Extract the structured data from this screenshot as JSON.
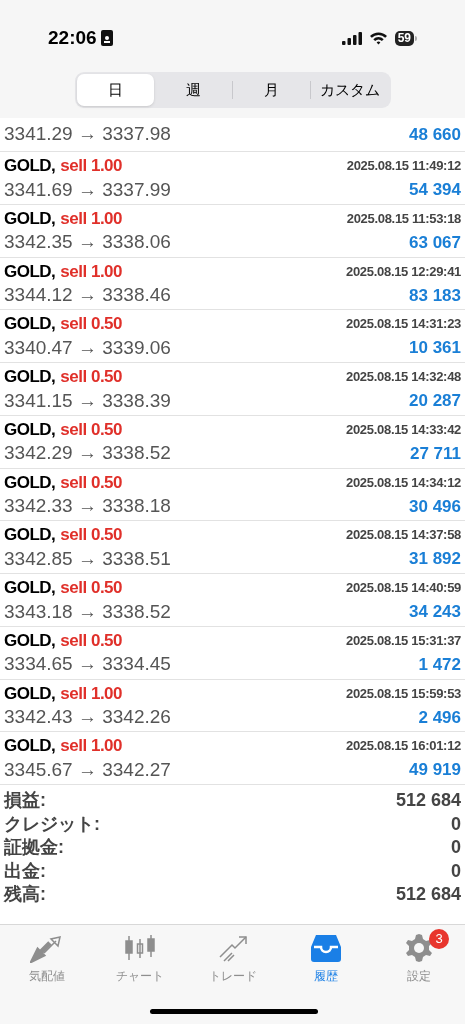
{
  "status_bar": {
    "time": "22:06",
    "battery": "59"
  },
  "period_tabs": [
    {
      "label": "日",
      "selected": true
    },
    {
      "label": "週",
      "selected": false
    },
    {
      "label": "月",
      "selected": false
    },
    {
      "label": "カスタム",
      "selected": false
    }
  ],
  "partial_row": {
    "prices": "3341.29 → 3337.98",
    "profit": "48 660"
  },
  "deals": [
    {
      "symbol": "GOLD,",
      "type": "sell 1.00",
      "time": "2025.08.15 11:49:12",
      "prices": "3341.69 → 3337.99",
      "profit": "54 394"
    },
    {
      "symbol": "GOLD,",
      "type": "sell 1.00",
      "time": "2025.08.15 11:53:18",
      "prices": "3342.35 → 3338.06",
      "profit": "63 067"
    },
    {
      "symbol": "GOLD,",
      "type": "sell 1.00",
      "time": "2025.08.15 12:29:41",
      "prices": "3344.12 → 3338.46",
      "profit": "83 183"
    },
    {
      "symbol": "GOLD,",
      "type": "sell 0.50",
      "time": "2025.08.15 14:31:23",
      "prices": "3340.47 → 3339.06",
      "profit": "10 361"
    },
    {
      "symbol": "GOLD,",
      "type": "sell 0.50",
      "time": "2025.08.15 14:32:48",
      "prices": "3341.15 → 3338.39",
      "profit": "20 287"
    },
    {
      "symbol": "GOLD,",
      "type": "sell 0.50",
      "time": "2025.08.15 14:33:42",
      "prices": "3342.29 → 3338.52",
      "profit": "27 711"
    },
    {
      "symbol": "GOLD,",
      "type": "sell 0.50",
      "time": "2025.08.15 14:34:12",
      "prices": "3342.33 → 3338.18",
      "profit": "30 496"
    },
    {
      "symbol": "GOLD,",
      "type": "sell 0.50",
      "time": "2025.08.15 14:37:58",
      "prices": "3342.85 → 3338.51",
      "profit": "31 892"
    },
    {
      "symbol": "GOLD,",
      "type": "sell 0.50",
      "time": "2025.08.15 14:40:59",
      "prices": "3343.18 → 3338.52",
      "profit": "34 243"
    },
    {
      "symbol": "GOLD,",
      "type": "sell 0.50",
      "time": "2025.08.15 15:31:37",
      "prices": "3334.65 → 3334.45",
      "profit": "1 472"
    },
    {
      "symbol": "GOLD,",
      "type": "sell 1.00",
      "time": "2025.08.15 15:59:53",
      "prices": "3342.43 → 3342.26",
      "profit": "2 496"
    },
    {
      "symbol": "GOLD,",
      "type": "sell 1.00",
      "time": "2025.08.15 16:01:12",
      "prices": "3345.67 → 3342.27",
      "profit": "49 919"
    }
  ],
  "summary": [
    {
      "label": "損益:",
      "value": "512 684"
    },
    {
      "label": "クレジット:",
      "value": "0"
    },
    {
      "label": "証拠金:",
      "value": "0"
    },
    {
      "label": "出金:",
      "value": "0"
    },
    {
      "label": "残高:",
      "value": "512 684"
    }
  ],
  "tab_bar": [
    {
      "kind": "quotes",
      "label": "気配値",
      "selected": false
    },
    {
      "kind": "chart",
      "label": "チャート",
      "selected": false
    },
    {
      "kind": "trade",
      "label": "トレード",
      "selected": false
    },
    {
      "kind": "history",
      "label": "履歴",
      "selected": true
    },
    {
      "kind": "settings",
      "label": "設定",
      "selected": false,
      "badge": "3"
    }
  ]
}
